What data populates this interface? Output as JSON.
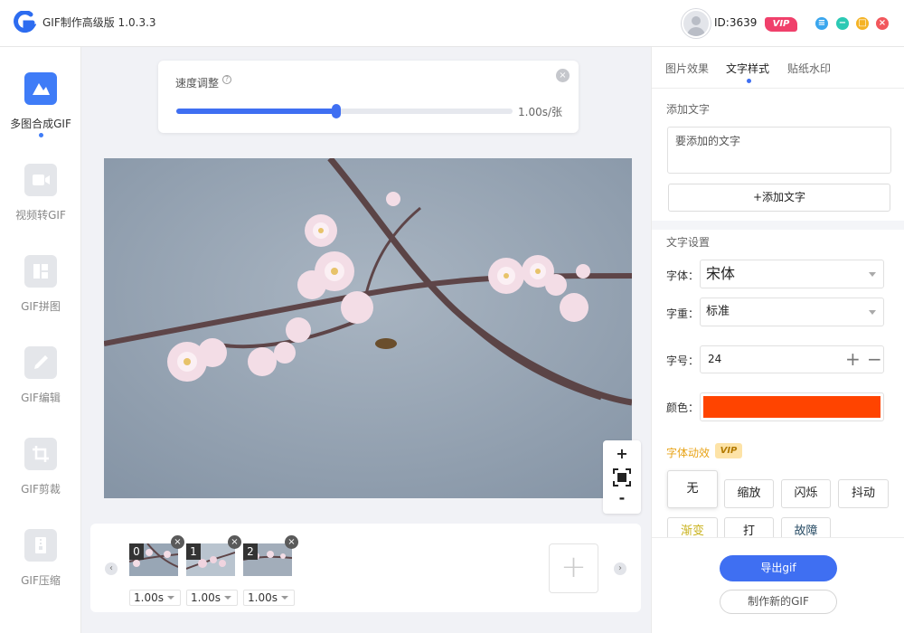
{
  "app": {
    "title": "GIF制作高级版 1.0.3.3"
  },
  "user": {
    "id": "ID:3639",
    "vip": "VIP"
  },
  "colors": {
    "accent": "#3f6ff2",
    "text_color_value": "#ff4400",
    "vip_pink": "#f0406b",
    "anim_gold": "#e8a317"
  },
  "window_controls": [
    {
      "name": "feedback-icon",
      "glyph": "≡",
      "color": "#3aa6ee"
    },
    {
      "name": "minimize-icon",
      "glyph": "−",
      "color": "#2bc9b4"
    },
    {
      "name": "maximize-icon",
      "glyph": "□",
      "color": "#f5b324"
    },
    {
      "name": "close-icon",
      "glyph": "×",
      "color": "#f2575c"
    }
  ],
  "sidebar": {
    "items": [
      {
        "label": "多图合成GIF",
        "icon": "image-mountain-icon",
        "active": true
      },
      {
        "label": "视频转GIF",
        "icon": "video-icon",
        "active": false
      },
      {
        "label": "GIF拼图",
        "icon": "layout-icon",
        "active": false
      },
      {
        "label": "GIF编辑",
        "icon": "edit-pen-icon",
        "active": false
      },
      {
        "label": "GIF剪裁",
        "icon": "crop-icon",
        "active": false
      },
      {
        "label": "GIF压缩",
        "icon": "compress-icon",
        "active": false
      }
    ]
  },
  "speed": {
    "label": "速度调整",
    "value_text": "1.00s/张",
    "fraction": 0.475
  },
  "zoom": {
    "plus": "+",
    "minus": "-"
  },
  "frames": [
    {
      "index": "0",
      "time": "1.00s"
    },
    {
      "index": "1",
      "time": "1.00s"
    },
    {
      "index": "2",
      "time": "1.00s"
    }
  ],
  "filmstrip": {
    "add": "+",
    "prev": "‹",
    "next": "›"
  },
  "right": {
    "tabs": [
      {
        "label": "图片效果",
        "active": false
      },
      {
        "label": "文字样式",
        "active": true
      },
      {
        "label": "贴纸水印",
        "active": false
      }
    ],
    "add_text_label": "添加文字",
    "text_placeholder": "要添加的文字",
    "add_text_button": "+添加文字",
    "text_settings_label": "文字设置",
    "font_label": "字体：",
    "font_value": "宋体",
    "weight_label": "字重：",
    "weight_value": "标准",
    "size_label": "字号：",
    "size_value": "24",
    "size_plus": "+",
    "size_minus": "−",
    "color_label": "颜色：",
    "anim_label": "字体动效",
    "anim_vip": "VIP",
    "effects": [
      "无",
      "缩放",
      "闪烁",
      "抖动",
      "渐变",
      "打",
      "故障"
    ],
    "export_button": "导出gif",
    "new_button": "制作新的GIF"
  }
}
